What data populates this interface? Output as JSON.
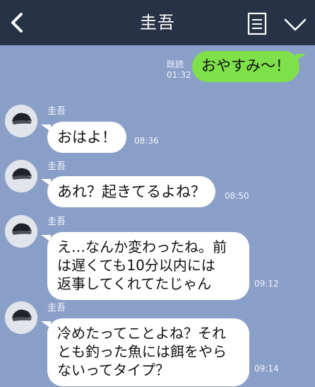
{
  "header": {
    "title": "圭吾"
  },
  "messages": {
    "m0": {
      "text": "おやすみ〜！",
      "read_label": "既読",
      "time": "01:32"
    },
    "m1": {
      "sender": "圭吾",
      "text": "おはよ！",
      "time": "08:36"
    },
    "m2": {
      "sender": "圭吾",
      "text": "あれ？起きてるよね？",
      "time": "08:50"
    },
    "m3": {
      "sender": "圭吾",
      "text": "え…なんか変わったね。前\nは遅くても10分以内には\n返事してくれてたじゃん",
      "time": "09:12"
    },
    "m4": {
      "sender": "圭吾",
      "text": "冷めたってことよね？それ\nとも釣った魚には餌をやら\nないってタイプ？",
      "time": "09:14"
    }
  },
  "colors": {
    "header_bg": "#273246",
    "chat_bg": "#8a9fc8",
    "outgoing_bubble": "#7fe14a",
    "incoming_bubble": "#ffffff"
  }
}
